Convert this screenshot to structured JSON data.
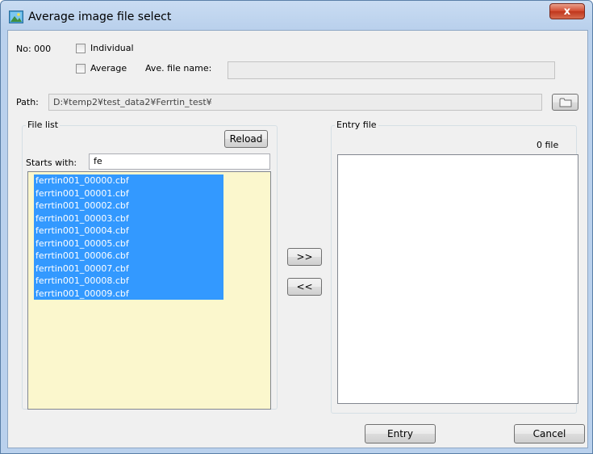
{
  "window": {
    "title": "Average image file select",
    "close_glyph": "x"
  },
  "header": {
    "no_label": "No: 000",
    "individual_label": "Individual",
    "individual_checked": false,
    "average_label": "Average",
    "average_checked": false,
    "ave_file_name_label": "Ave. file name:",
    "ave_file_name_value": ""
  },
  "path": {
    "label": "Path:",
    "value": "D:¥temp2¥test_data2¥Ferrtin_test¥",
    "browse_icon": "folder-icon"
  },
  "file_list": {
    "title": "File list",
    "reload_label": "Reload",
    "starts_with_label": "Starts with:",
    "starts_with_value": "fe",
    "items": [
      "ferrtin001_00000.cbf",
      "ferrtin001_00001.cbf",
      "ferrtin001_00002.cbf",
      "ferrtin001_00003.cbf",
      "ferrtin001_00004.cbf",
      "ferrtin001_00005.cbf",
      "ferrtin001_00006.cbf",
      "ferrtin001_00007.cbf",
      "ferrtin001_00008.cbf",
      "ferrtin001_00009.cbf"
    ]
  },
  "transfer": {
    "add_label": ">>",
    "remove_label": "<<"
  },
  "entry_file": {
    "title": "Entry file",
    "count_label": "0 file",
    "items": []
  },
  "footer": {
    "entry_label": "Entry",
    "cancel_label": "Cancel"
  },
  "colors": {
    "selection": "#3399ff",
    "list_background": "#fbf7cd",
    "title_bar": "#b9d0ec",
    "close_button": "#c0361c"
  }
}
